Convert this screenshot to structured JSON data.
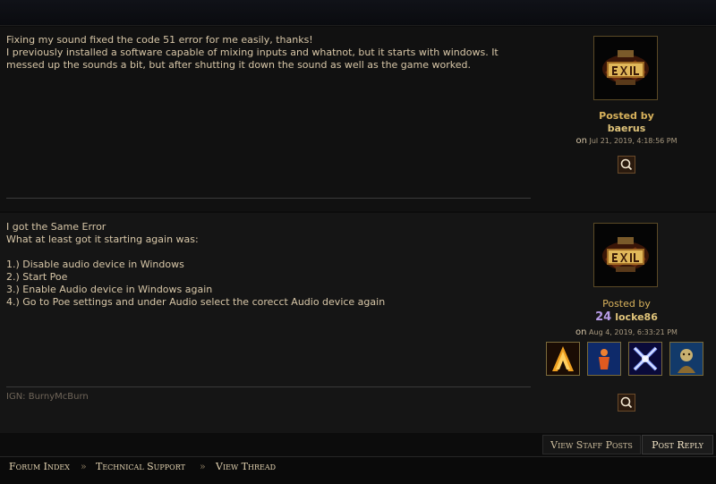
{
  "posts": [
    {
      "body": "Fixing my sound fixed the code 51 error for me easily, thanks!\nI previously installed a software capable of mixing inputs and whatnot, but it starts with windows. It messed up the sounds a bit, but after shutting it down the sound as well as the game worked.",
      "posted_by_label": "Posted by",
      "author": "baerus",
      "on_label": "on",
      "date": "Jul 21, 2019, 4:18:56 PM",
      "avatar_icon": "path-of-exile-logo-icon",
      "quote_icon": "quote-search-icon"
    },
    {
      "body": "I got the Same Error\nWhat at least got it starting again was:\n\n1.) Disable audio device in Windows\n2.) Start Poe\n3.) Enable Audio device in Windows again\n4.) Go to Poe settings and under Audio select the corecct Audio device again",
      "ign": "IGN: BurnyMcBurn",
      "posted_by_label": "Posted by",
      "level": "24",
      "author": "locke86",
      "on_label": "on",
      "date": "Aug 4, 2019, 6:33:21 PM",
      "avatar_icon": "path-of-exile-logo-icon",
      "quote_icon": "quote-search-icon",
      "badges": [
        "supporter-badge-a",
        "supporter-badge-figure",
        "supporter-badge-x",
        "supporter-badge-portrait"
      ]
    }
  ],
  "actions": {
    "view_staff_posts": "View Staff Posts",
    "post_reply": "Post Reply"
  },
  "breadcrumb": {
    "items": [
      "Forum Index",
      "Technical Support",
      "View Thread"
    ],
    "separator": "»"
  },
  "colors": {
    "accent": "#d8b25c",
    "text": "#d8c7a8",
    "background": "#121212"
  }
}
